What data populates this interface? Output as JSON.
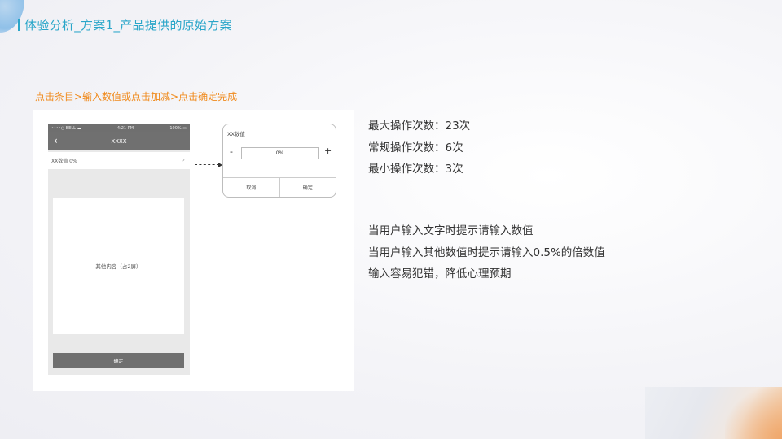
{
  "slide": {
    "title": "体验分析_方案1_产品提供的原始方案",
    "flow_caption": "点击条目>输入数值或点击加减>点击确定完成"
  },
  "phone": {
    "status_left": "••••○ BELL ☁",
    "status_time": "4:21 PM",
    "status_right": "100% ▭",
    "nav_title": "XXXX",
    "list_row_label": "XX数值  0%",
    "content_placeholder": "其他内容（占2屏）",
    "confirm_label": "确定"
  },
  "dialog": {
    "title": "XX数值",
    "minus": "-",
    "value": "0%",
    "plus": "+",
    "cancel_label": "取消",
    "ok_label": "确定"
  },
  "stats": [
    "最大操作次数：23次",
    "常规操作次数：6次",
    "最小操作次数：3次"
  ],
  "notes": [
    "当用户输入文字时提示请输入数值",
    "当用户输入其他数值时提示请输入0.5%的倍数值",
    "输入容易犯错，降低心理预期"
  ],
  "colors": {
    "title_accent": "#2aa6c9",
    "flow_caption": "#f08a1c",
    "nav_gray": "#707070"
  }
}
